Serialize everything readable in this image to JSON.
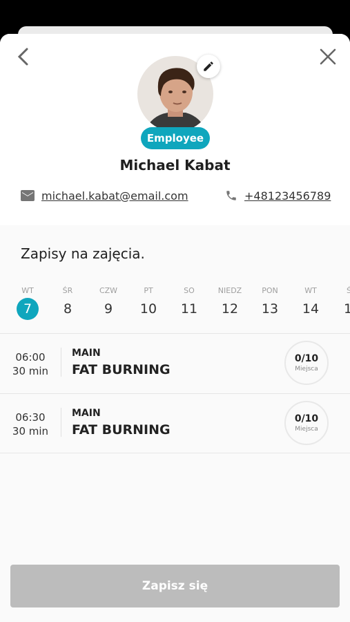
{
  "header": {
    "back_icon": "chevron-left-icon",
    "close_icon": "close-icon",
    "edit_icon": "pencil-icon"
  },
  "profile": {
    "badge": "Employee",
    "name": "Michael Kabat",
    "email": "michael.kabat@email.com",
    "phone": "+48123456789",
    "email_icon": "mail-icon",
    "phone_icon": "phone-icon"
  },
  "colors": {
    "accent": "#0fa6bd",
    "button_disabled": "#bcbcbc"
  },
  "schedule": {
    "title": "Zapisy na zajęcia.",
    "days": [
      {
        "name": "WT",
        "date": "7",
        "selected": true
      },
      {
        "name": "ŚR",
        "date": "8"
      },
      {
        "name": "CZW",
        "date": "9"
      },
      {
        "name": "PT",
        "date": "10"
      },
      {
        "name": "SO",
        "date": "11"
      },
      {
        "name": "NIEDZ",
        "date": "12"
      },
      {
        "name": "PON",
        "date": "13"
      },
      {
        "name": "WT",
        "date": "14"
      },
      {
        "name": "Ś",
        "date": "1"
      }
    ],
    "classes": [
      {
        "time": "06:00",
        "duration": "30 min",
        "category": "MAIN",
        "title": "FAT BURNING",
        "spots": "0/10",
        "spots_label": "Miejsca"
      },
      {
        "time": "06:30",
        "duration": "30 min",
        "category": "MAIN",
        "title": "FAT BURNING",
        "spots": "0/10",
        "spots_label": "Miejsca"
      }
    ]
  },
  "submit_label": "Zapisz się"
}
